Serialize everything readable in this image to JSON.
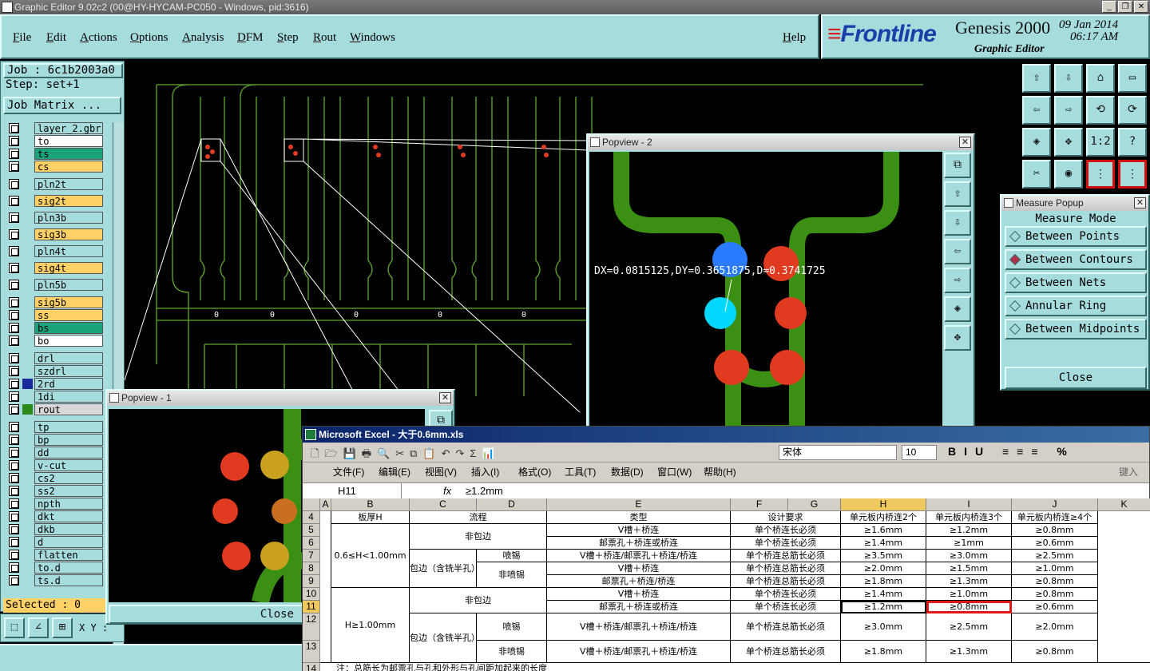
{
  "window": {
    "title": "Graphic Editor 9.02c2 (00@HY-HYCAM-PC050 - Windows, pid:3616)",
    "btns": [
      "_",
      "❐",
      "✕"
    ]
  },
  "menu": {
    "items": [
      "File",
      "Edit",
      "Actions",
      "Options",
      "Analysis",
      "DFM",
      "Step",
      "Rout",
      "Windows"
    ],
    "help": "Help"
  },
  "brand": {
    "logo": "Frontline",
    "product": "Genesis 2000",
    "subtitle": "Graphic Editor",
    "date": "09 Jan 2014",
    "time": "06:17 AM"
  },
  "job": {
    "job": "Job : 6c1b2003a0",
    "step": "Step: set+1",
    "matrix_btn": "Job Matrix ..."
  },
  "layers": [
    {
      "name": "layer_2.gbr",
      "color": "#a6dcdc"
    },
    {
      "name": "to",
      "color": "#ffffff"
    },
    {
      "name": "ts",
      "color": "#1aa37a"
    },
    {
      "name": "cs",
      "color": "#ffd166"
    },
    {
      "name": "pln2t",
      "color": "#a6dcdc"
    },
    {
      "name": "sig2t",
      "color": "#ffd166"
    },
    {
      "name": "pln3b",
      "color": "#a6dcdc"
    },
    {
      "name": "sig3b",
      "color": "#ffd166"
    },
    {
      "name": "pln4t",
      "color": "#a6dcdc"
    },
    {
      "name": "sig4t",
      "color": "#ffd166"
    },
    {
      "name": "pln5b",
      "color": "#a6dcdc"
    },
    {
      "name": "sig5b",
      "color": "#ffd166"
    },
    {
      "name": "ss",
      "color": "#ffd166"
    },
    {
      "name": "bs",
      "color": "#1aa37a"
    },
    {
      "name": "bo",
      "color": "#ffffff"
    },
    {
      "name": "drl",
      "color": "#a6dcdc"
    },
    {
      "name": "szdrl",
      "color": "#a6dcdc"
    },
    {
      "name": "2rd",
      "color": "#a6dcdc"
    },
    {
      "name": "1di",
      "color": "#a6dcdc"
    },
    {
      "name": "rout",
      "color": "#d8d8d8"
    },
    {
      "name": "tp",
      "color": "#a6dcdc"
    },
    {
      "name": "bp",
      "color": "#a6dcdc"
    },
    {
      "name": "dd",
      "color": "#a6dcdc"
    },
    {
      "name": "v-cut",
      "color": "#a6dcdc"
    },
    {
      "name": "cs2",
      "color": "#a6dcdc"
    },
    {
      "name": "ss2",
      "color": "#a6dcdc"
    },
    {
      "name": "npth",
      "color": "#a6dcdc"
    },
    {
      "name": "dkt",
      "color": "#a6dcdc"
    },
    {
      "name": "dkb",
      "color": "#a6dcdc"
    },
    {
      "name": "d",
      "color": "#a6dcdc"
    },
    {
      "name": "flatten",
      "color": "#a6dcdc"
    },
    {
      "name": "to.d",
      "color": "#a6dcdc"
    },
    {
      "name": "ts.d",
      "color": "#a6dcdc"
    }
  ],
  "selected": "Selected : 0",
  "xy_label": "X Y :",
  "canvas": {
    "slot_labels": [
      "0",
      "0",
      "0",
      "0",
      "0"
    ]
  },
  "popview2": {
    "title": "Popview - 2",
    "measure": "DX=0.0815125,DY=0.3651875,D=0.3741725"
  },
  "popview1": {
    "title": "Popview - 1",
    "close": "Close"
  },
  "measure": {
    "title": "Measure Popup",
    "heading": "Measure Mode",
    "modes": [
      "Between Points",
      "Between Contours",
      "Between Nets",
      "Annular Ring",
      "Between Midpoints"
    ],
    "selected": "Between Contours",
    "close": "Close"
  },
  "tools": [
    "⇧",
    "⇩",
    "⌂",
    "▭",
    "⇦",
    "⇨",
    "⟲",
    "⟳",
    "◈",
    "✥",
    "1:2",
    "?",
    "✂",
    "◉",
    "⋮",
    "⋮"
  ],
  "excel": {
    "title": "Microsoft Excel - 大于0.6mm.xls",
    "font": "宋体",
    "font_size": "10",
    "menu": [
      "文件(F)",
      "编辑(E)",
      "视图(V)",
      "插入(I)",
      "格式(O)",
      "工具(T)",
      "数据(D)",
      "窗口(W)",
      "帮助(H)"
    ],
    "help_hint": "键入",
    "namebox": "H11",
    "fx": "fx",
    "formula": "≥1.2mm",
    "columns": [
      "A",
      "B",
      "C",
      "D",
      "E",
      "F",
      "G",
      "H",
      "I",
      "J",
      "K"
    ],
    "rows": [
      "4",
      "5",
      "6",
      "7",
      "8",
      "9",
      "10",
      "11",
      "12",
      "13",
      "14"
    ],
    "header": {
      "thickness": "板厚H",
      "flow": "流程",
      "type": "类型",
      "req": "设计要求",
      "h2": "单元板内桥连2个",
      "h3": "单元板内桥连3个",
      "h4": "单元板内桥连≥4个"
    },
    "group1": "0.6≤H<1.00mm",
    "group2": "H≥1.00mm",
    "nonwrap": "非包边",
    "wrap": "包边（含铣半孔）",
    "spray": "喷锡",
    "nospray": "非喷锡",
    "data": [
      {
        "type": "V槽＋桥连",
        "req": "单个桥连长必须",
        "h": "≥1.6mm",
        "i": "≥1.2mm",
        "j": "≥0.8mm"
      },
      {
        "type": "邮票孔＋桥连或桥连",
        "req": "单个桥连长必须",
        "h": "≥1.4mm",
        "i": "≥1mm",
        "j": "≥0.6mm"
      },
      {
        "type": "V槽＋桥连/邮票孔＋桥连/桥连",
        "req": "单个桥连总筋长必须",
        "h": "≥3.5mm",
        "i": "≥3.0mm",
        "j": "≥2.5mm"
      },
      {
        "type": "V槽＋桥连",
        "req": "单个桥连总筋长必须",
        "h": "≥2.0mm",
        "i": "≥1.5mm",
        "j": "≥1.0mm"
      },
      {
        "type": "邮票孔＋桥连/桥连",
        "req": "单个桥连总筋长必须",
        "h": "≥1.8mm",
        "i": "≥1.3mm",
        "j": "≥0.8mm"
      },
      {
        "type": "V槽＋桥连",
        "req": "单个桥连长必须",
        "h": "≥1.4mm",
        "i": "≥1.0mm",
        "j": "≥0.8mm"
      },
      {
        "type": "邮票孔＋桥连或桥连",
        "req": "单个桥连长必须",
        "h": "≥1.2mm",
        "i": "≥0.8mm",
        "j": "≥0.6mm"
      },
      {
        "type": "V槽＋桥连/邮票孔＋桥连/桥连",
        "req": "单个桥连总筋长必须",
        "h": "≥3.0mm",
        "i": "≥2.5mm",
        "j": "≥2.0mm"
      },
      {
        "type": "V槽＋桥连/邮票孔＋桥连/桥连",
        "req": "单个桥连总筋长必须",
        "h": "≥1.8mm",
        "i": "≥1.3mm",
        "j": "≥0.8mm"
      }
    ],
    "note": "注：总筋长为邮票孔与孔和外形与孔间距加起来的长度"
  }
}
